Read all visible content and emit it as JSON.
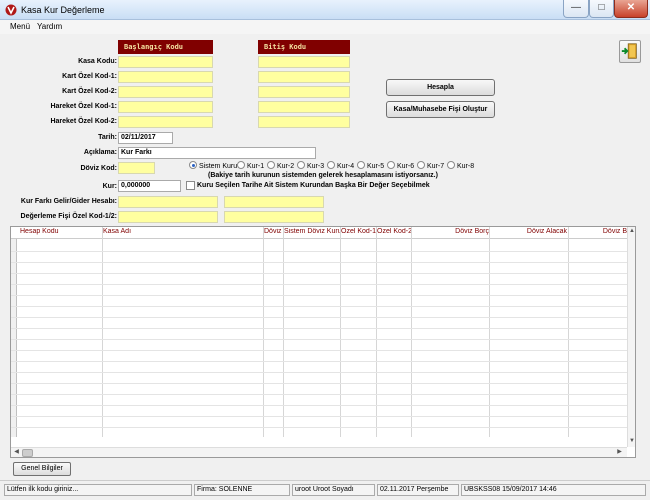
{
  "window": {
    "title": "Kasa Kur Değerleme",
    "minimize": "—",
    "maximize": "□",
    "close": "✕"
  },
  "menu": {
    "items": [
      "Menü",
      "Yardım"
    ]
  },
  "form": {
    "header_start": "Başlangıç Kodu",
    "header_end": "Bitiş Kodu",
    "labels": {
      "kasa_kodu": "Kasa Kodu:",
      "kart_ozel_kod1": "Kart Özel Kod-1:",
      "kart_ozel_kod2": "Kart Özel Kod-2:",
      "hareket_ozel_kod1": "Hareket Özel Kod-1:",
      "hareket_ozel_kod2": "Hareket Özel Kod-2:",
      "tarih": "Tarih:",
      "aciklama": "Açıklama:",
      "doviz_kod": "Döviz Kod:",
      "kur": "Kur:",
      "kur_farki_hesabi": "Kur Farkı Gelir/Gider Hesabı:",
      "degerleme_fisi_ozel_kod": "Değerleme Fişi Özel Kod-1/2:"
    },
    "values": {
      "tarih": "02/11/2017",
      "aciklama": "Kur Farkı",
      "kur": "0,000000"
    },
    "buttons": {
      "hesapla": "Hesapla",
      "fis_olustur": "Kasa/Muhasebe Fişi Oluştur"
    },
    "kur_options": [
      "Sistem Kuru",
      "Kur-1",
      "Kur-2",
      "Kur-3",
      "Kur-4",
      "Kur-5",
      "Kur-6",
      "Kur-7",
      "Kur-8"
    ],
    "kur_note": "(Bakiye tarih kurunun sistemden gelerek hesaplamasını istiyorsanız.)",
    "checkbox_label": "Kuru Seçilen Tarihe Ait Sistem Kurundan Başka Bir Değer Seçebilmek"
  },
  "grid": {
    "columns": [
      "Hesap Kodu",
      "Kasa Adı",
      "Döviz",
      "Sistem Döviz Kuru",
      "Özel Kod-1",
      "Özel Kod-2",
      "Döviz Borç",
      "Döviz Alacak",
      "Döviz B"
    ]
  },
  "bottom": {
    "genel_bilgiler": "Genel Bilgiler"
  },
  "status": {
    "message": "Lütfen ilk kodu giriniz...",
    "firma": "Firma: SOLENNE",
    "user": "uroot Uroot Soyadı",
    "date": "02.11.2017  Perşembe",
    "version": "UBSKSS08 15/09/2017 14:46"
  }
}
